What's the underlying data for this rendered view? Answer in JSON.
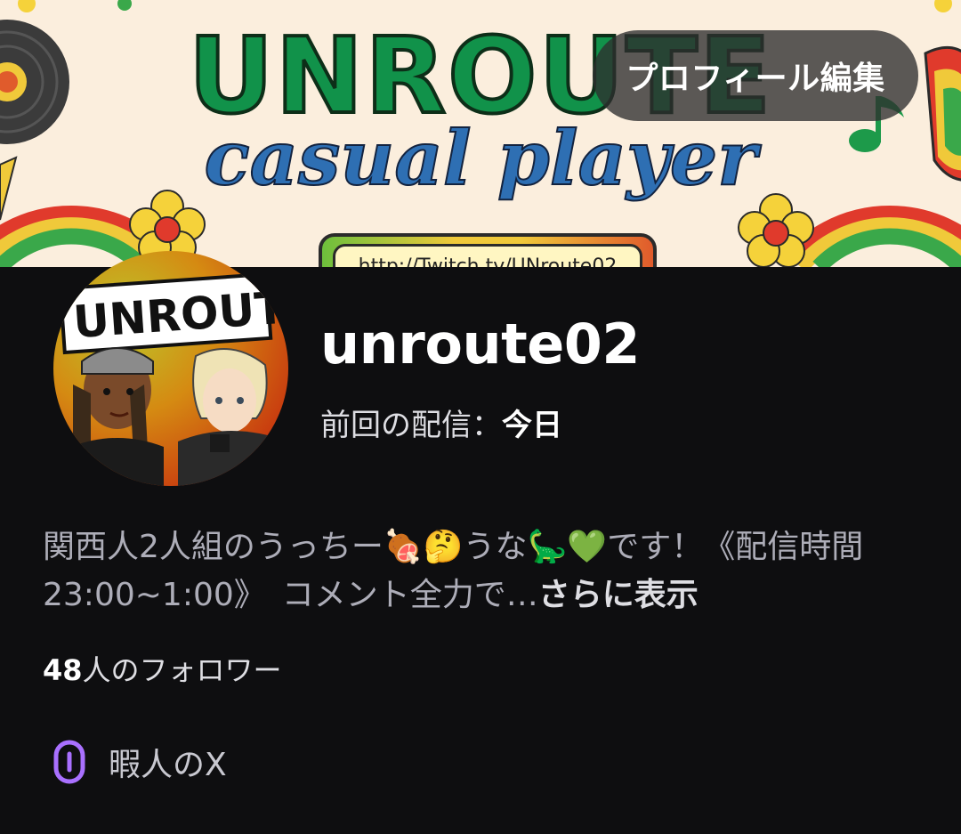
{
  "banner": {
    "title": "UNROUTE",
    "subtitle": "casual player",
    "link": "http://Twitch.tv/UNroute02"
  },
  "edit_button": {
    "label": "プロフィール編集"
  },
  "avatar": {
    "text": "UNROUT"
  },
  "profile": {
    "channel_name": "unroute02",
    "last_stream_label": "前回の配信：",
    "last_stream_value": "今日"
  },
  "bio": {
    "text": "関西人2人組のうっちー🍖🤔うな🦕💚です！《配信時間 23:00~1:00》　コメント全力で…",
    "more_label": "さらに表示"
  },
  "followers": {
    "count": "48",
    "label": "人のフォロワー"
  },
  "social_link": {
    "icon": "link-icon",
    "label": "暇人のX",
    "accent_color": "#a970ff"
  }
}
